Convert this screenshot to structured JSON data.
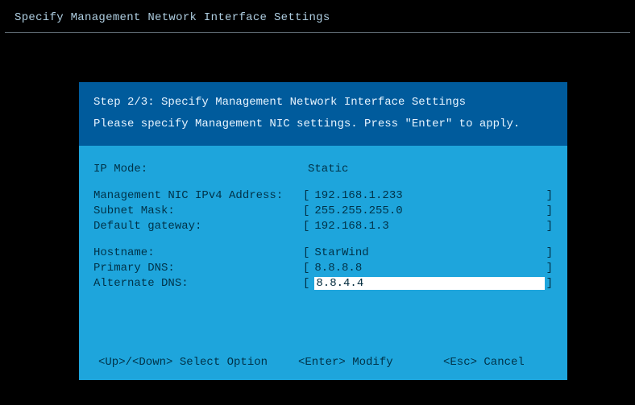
{
  "page": {
    "title": "Specify Management Network Interface Settings"
  },
  "header": {
    "step_line": "Step 2/3: Specify Management Network Interface Settings",
    "instruction": "Please specify Management NIC settings. Press \"Enter\" to apply."
  },
  "fields": {
    "ip_mode": {
      "label": "IP Mode:",
      "value": "Static"
    },
    "ipv4": {
      "label": "Management NIC IPv4 Address:",
      "value": "192.168.1.233"
    },
    "subnet": {
      "label": "Subnet Mask:",
      "value": "255.255.255.0"
    },
    "gateway": {
      "label": "Default gateway:",
      "value": "192.168.1.3"
    },
    "hostname": {
      "label": "Hostname:",
      "value": "StarWind"
    },
    "primary_dns": {
      "label": "Primary DNS:",
      "value": "8.8.8.8"
    },
    "alt_dns": {
      "label": "Alternate DNS:",
      "value": "8.8.4.4"
    }
  },
  "footer": {
    "select": "<Up>/<Down> Select Option",
    "modify": "<Enter> Modify",
    "cancel": "<Esc> Cancel"
  }
}
